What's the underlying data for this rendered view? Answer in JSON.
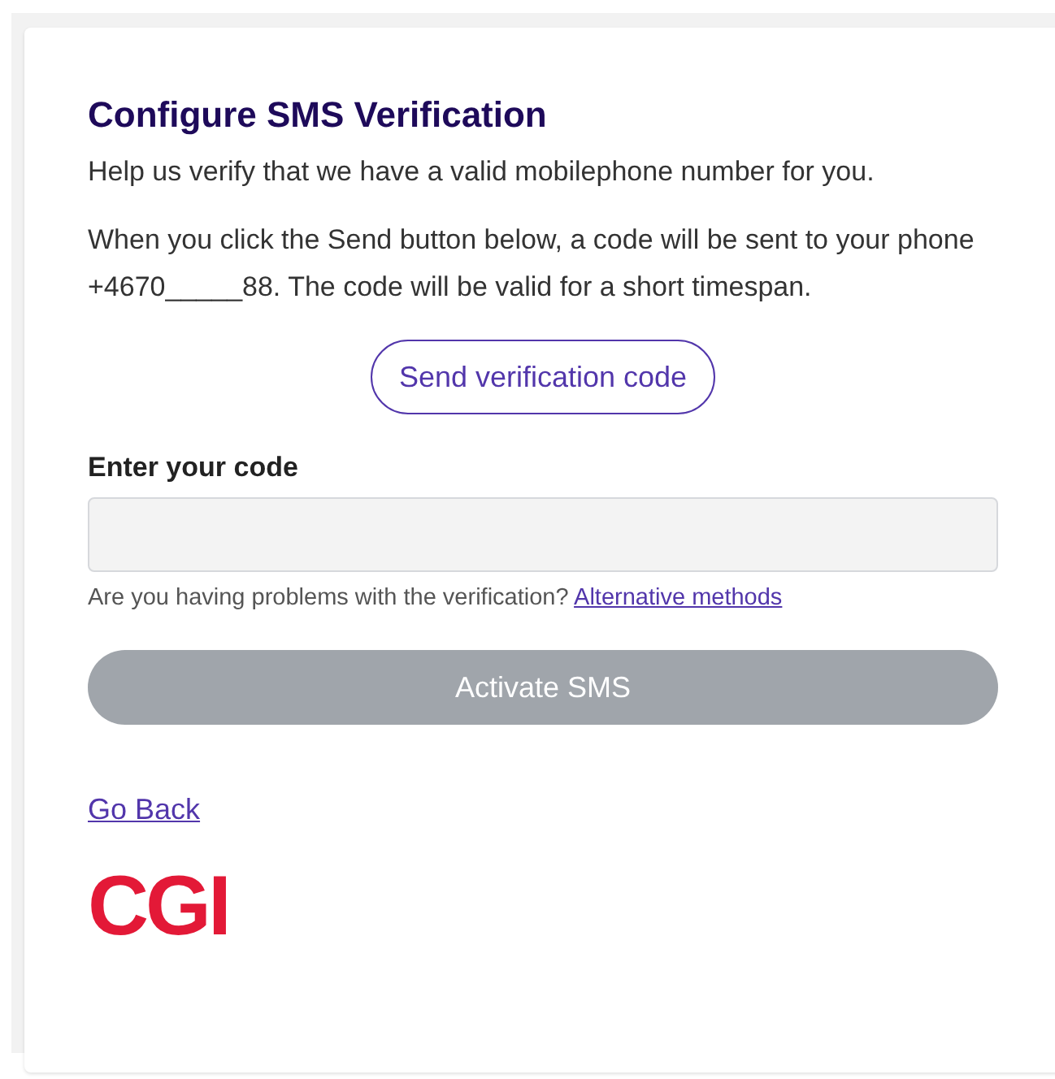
{
  "title": "Configure SMS Verification",
  "intro": "Help us verify that we have a valid mobilephone number for you.",
  "explanation": "When you click the Send button below, a code will be sent to your phone +4670_____88. The code will be valid for a short timespan.",
  "send_button": "Send verification code",
  "code_field": {
    "label": "Enter your code"
  },
  "help": {
    "text": "Are you having problems with the verification?",
    "link": "Alternative methods"
  },
  "activate_button": {
    "label": "Activate SMS",
    "disabled": true
  },
  "back_link": "Go Back",
  "logo": "CGI"
}
